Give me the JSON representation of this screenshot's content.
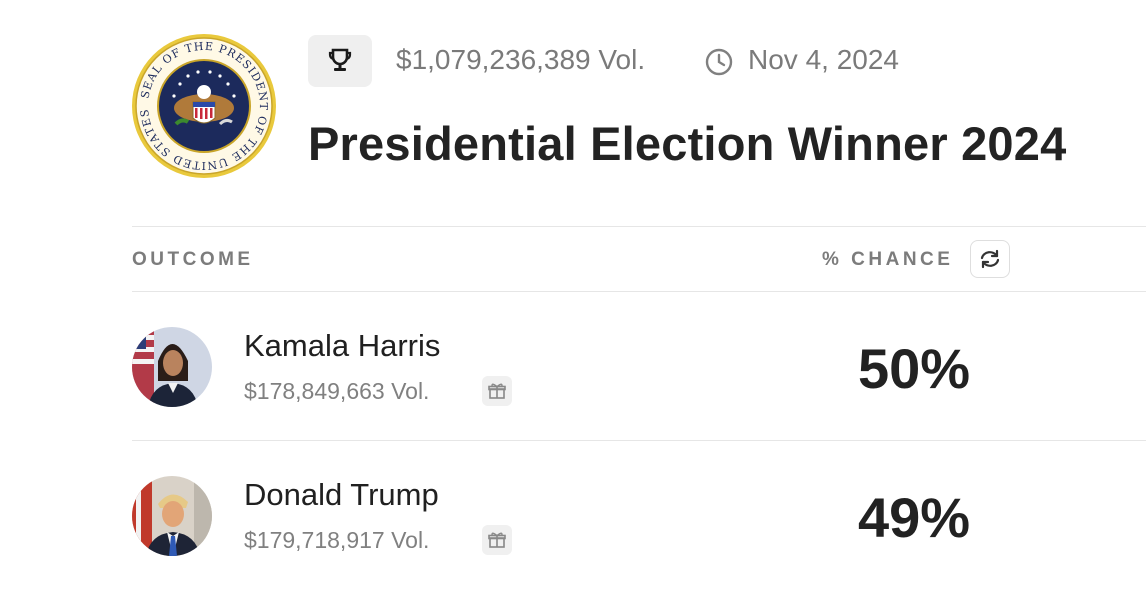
{
  "header": {
    "volume": "$1,079,236,389 Vol.",
    "date": "Nov 4, 2024",
    "title": "Presidential Election Winner 2024",
    "seal_text_top": "SEAL OF THE PRESIDENT OF THE UNITED STATES"
  },
  "table": {
    "col_outcome": "OUTCOME",
    "col_chance": "% CHANCE",
    "rows": [
      {
        "name": "Kamala Harris",
        "volume": "$178,849,663 Vol.",
        "chance": "50%"
      },
      {
        "name": "Donald Trump",
        "volume": "$179,718,917 Vol.",
        "chance": "49%"
      }
    ]
  },
  "icons": {
    "trophy": "trophy-icon",
    "clock": "clock-icon",
    "refresh": "refresh-icon",
    "gift": "gift-icon"
  },
  "colors": {
    "seal_gold": "#e9c93c",
    "seal_navy": "#1c2a5c",
    "muted_text": "#7a7a7a"
  }
}
